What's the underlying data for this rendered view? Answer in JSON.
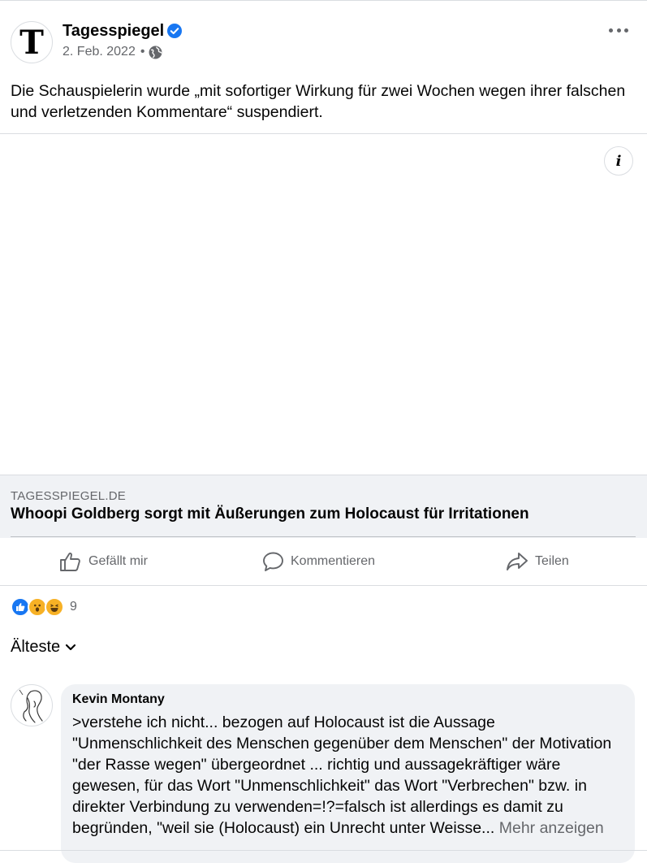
{
  "post": {
    "page_name": "Tagesspiegel",
    "avatar_letter": "T",
    "date": "2. Feb. 2022",
    "separator": "•",
    "text": "Die Schauspielerin wurde „mit sofortiger Wirkung für zwei Wochen wegen ihrer falschen und verletzenden Kommentare“ suspendiert.",
    "info_label": "i"
  },
  "link_card": {
    "domain": "TAGESSPIEGEL.DE",
    "title": "Whoopi Goldberg sorgt mit Äußerungen zum Holocaust für Irritationen"
  },
  "actions": {
    "like": "Gefällt mir",
    "comment": "Kommentieren",
    "share": "Teilen"
  },
  "reactions": {
    "count": "9",
    "icons": [
      "like",
      "wow",
      "haha"
    ]
  },
  "sort": {
    "label": "Älteste"
  },
  "comment": {
    "author": "Kevin Montany",
    "text": ">verstehe ich nicht... bezogen auf Holocaust ist die Aussage \"Unmenschlichkeit des Menschen gegenüber dem Menschen\" der Motivation \"der Rasse wegen\" übergeordnet ... richtig und aussagekräftiger wäre gewesen, für das Wort \"Unmenschlichkeit\" das Wort \"Verbrechen\" bzw. in direkter Verbindung zu verwenden=!?=falsch ist allerdings es damit zu begründen,  \"weil sie (Holocaust) ein Unrecht unter Weisse...",
    "more": "Mehr anzeigen"
  },
  "colors": {
    "brand_blue": "#1877f2",
    "secondary_text": "#65676b",
    "comment_bg": "#f0f2f5"
  }
}
